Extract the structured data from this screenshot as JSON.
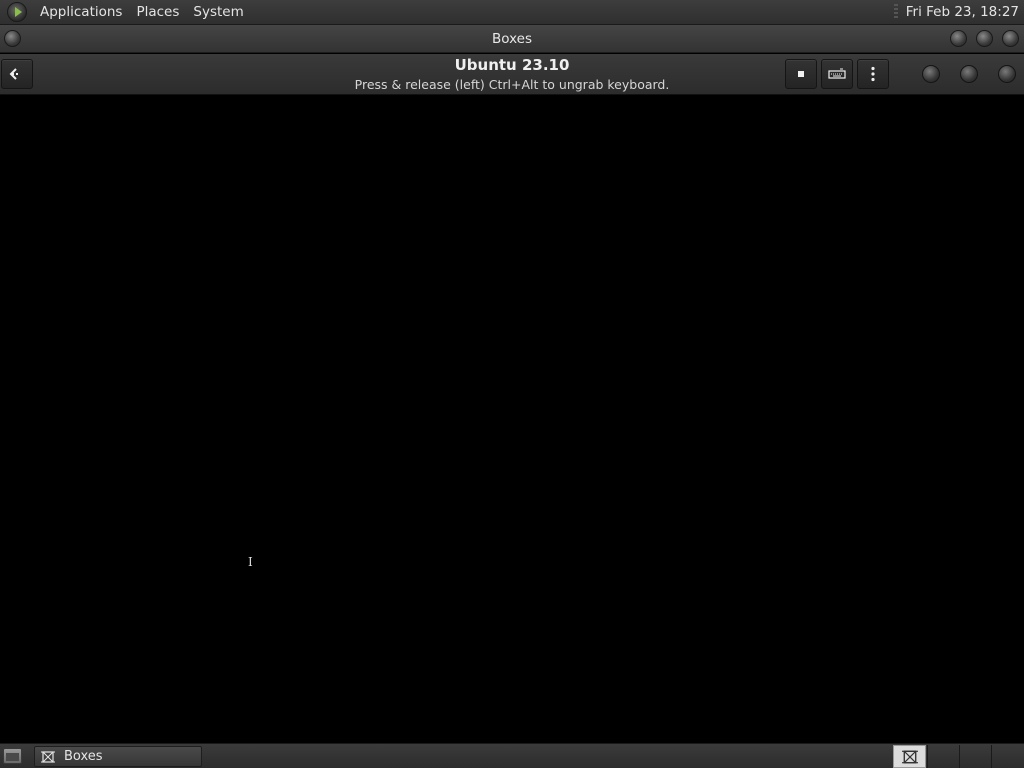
{
  "top_panel": {
    "menus": [
      "Applications",
      "Places",
      "System"
    ],
    "clock": "Fri Feb 23, 18:27"
  },
  "window": {
    "title": "Boxes"
  },
  "header": {
    "title": "Ubuntu 23.10",
    "subtitle": "Press & release (left) Ctrl+Alt to ungrab keyboard."
  },
  "taskbar": {
    "task_label": "Boxes"
  },
  "icons": {
    "menu_logo": "mate-menu-icon",
    "back": "back-arrow-icon",
    "stop": "stop-icon",
    "keyboard": "keyboard-icon",
    "menu": "kebab-menu-icon",
    "task": "boxes-app-icon",
    "show_desktop": "show-desktop-icon",
    "cursor": "text-cursor-icon"
  },
  "colors": {
    "panel_bg": "#333333",
    "vm_bg": "#000000",
    "text": "#e4e4e4"
  }
}
